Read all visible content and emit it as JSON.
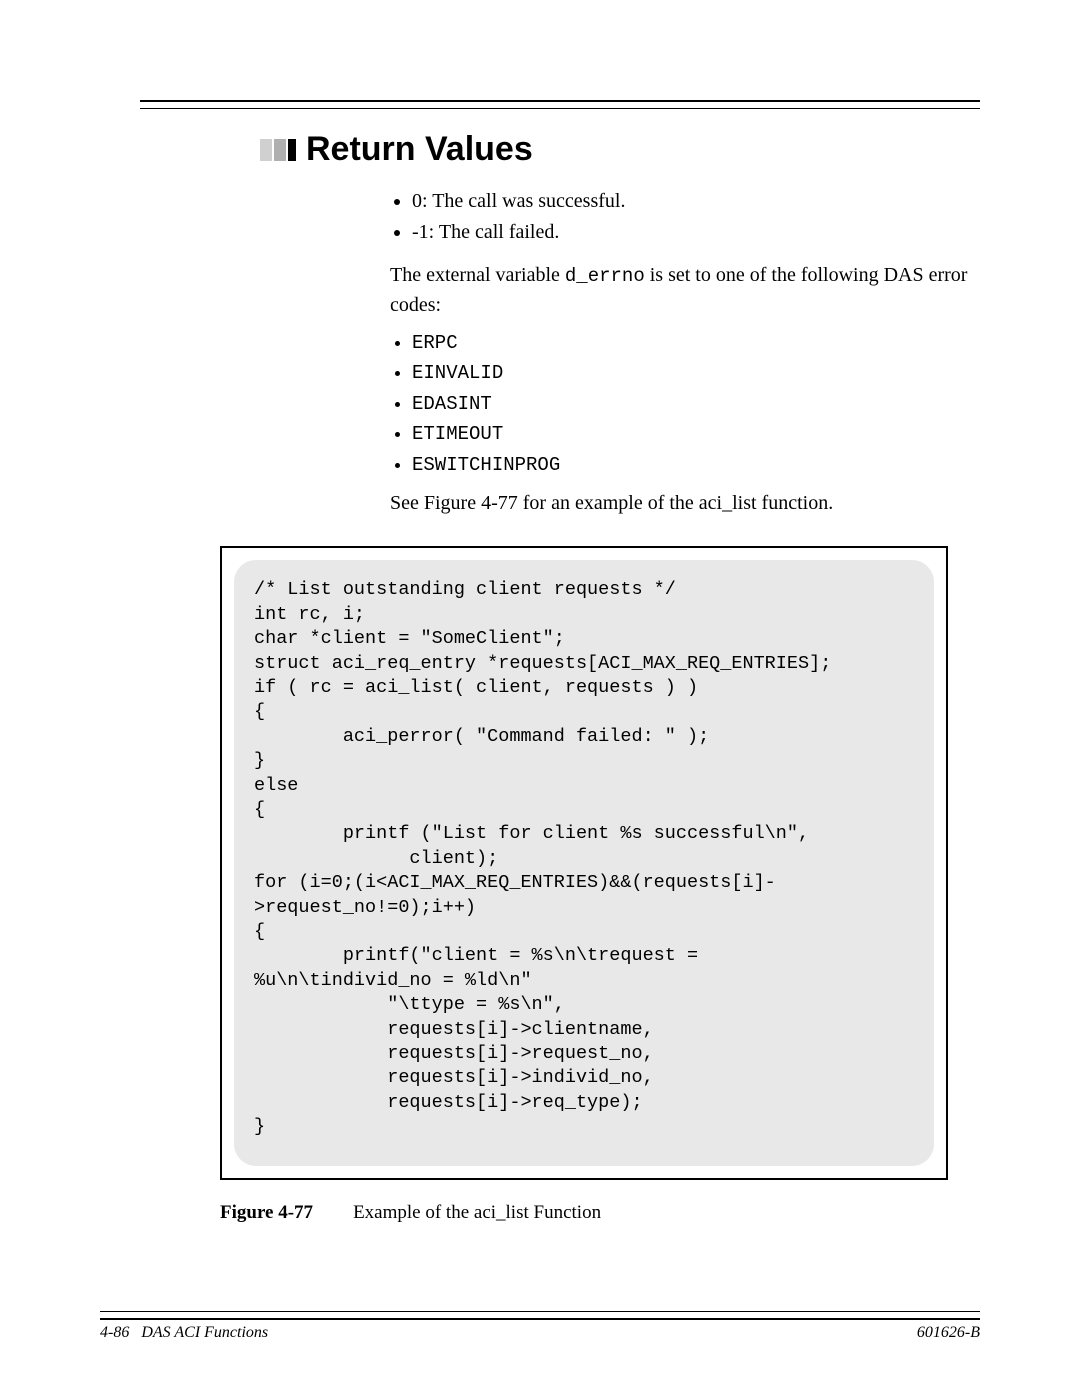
{
  "heading": "Return Values",
  "intro_bullets": [
    "0: The call was successful.",
    "-1: The call failed."
  ],
  "para_pre": "The external variable ",
  "para_code": "d_errno",
  "para_post": " is set to one of the following DAS error codes:",
  "error_codes": [
    "ERPC",
    "EINVALID",
    "EDASINT",
    "ETIMEOUT",
    "ESWITCHINPROG"
  ],
  "see_text": "See Figure 4-77 for an example of the aci_list function.",
  "code_block": "/* List outstanding client requests */\nint rc, i;\nchar *client = \"SomeClient\";\nstruct aci_req_entry *requests[ACI_MAX_REQ_ENTRIES];\nif ( rc = aci_list( client, requests ) )\n{\n        aci_perror( \"Command failed: \" );\n}\nelse\n{\n        printf (\"List for client %s successful\\n\",\n              client);\nfor (i=0;(i<ACI_MAX_REQ_ENTRIES)&&(requests[i]-\n>request_no!=0);i++)\n{\n        printf(\"client = %s\\n\\trequest = \n%u\\n\\tindivid_no = %ld\\n\"\n            \"\\ttype = %s\\n\",\n            requests[i]->clientname,\n            requests[i]->request_no,\n            requests[i]->individ_no,\n            requests[i]->req_type);\n}",
  "figure_number": "Figure 4-77",
  "figure_title": "Example of the aci_list Function",
  "footer_left_page": "4-86",
  "footer_left_title": "DAS ACI Functions",
  "footer_right": "601626-B"
}
